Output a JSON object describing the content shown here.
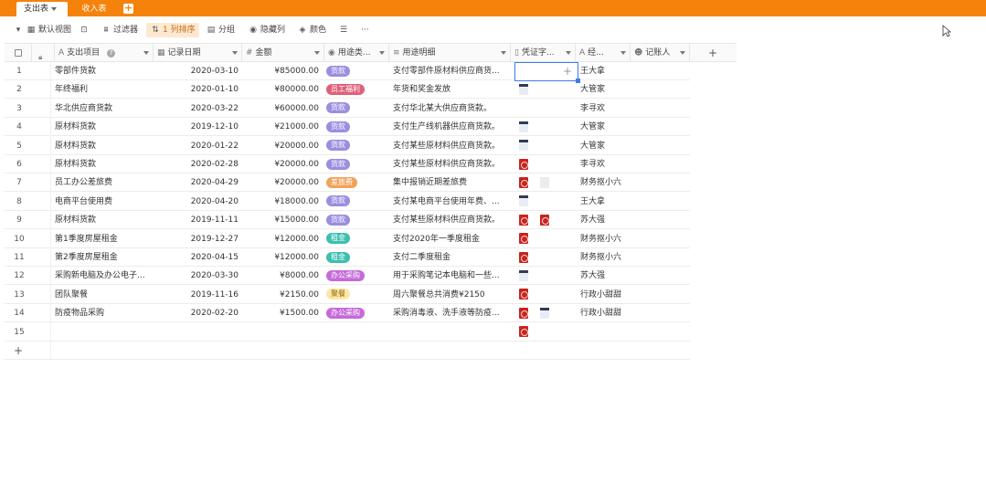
{
  "tabs": {
    "active": "支出表",
    "other": "收入表"
  },
  "toolbar": {
    "default_view": "默认视图",
    "filter": "过滤器",
    "sort": "1 列排序",
    "group": "分组",
    "hide": "隐藏列",
    "color": "颜色",
    "more": "···"
  },
  "columns": {
    "item": "支出项目",
    "date": "记录日期",
    "amount": "金额",
    "category": "用途类...",
    "description": "用途明细",
    "voucher": "凭证字...",
    "handler": "经...",
    "recorder": "记账人"
  },
  "rows": [
    {
      "idx": "1",
      "item": "零部件货款",
      "date": "2020-03-10",
      "amount": "¥85000.00",
      "cat": "货款",
      "desc": "支付零部件原材料供应商货...",
      "voucher": [],
      "handler": "王大拿"
    },
    {
      "idx": "2",
      "item": "年终福利",
      "date": "2020-01-10",
      "amount": "¥80000.00",
      "cat": "员工福利",
      "desc": "年货和奖金发放",
      "voucher": [
        "doc"
      ],
      "handler": "大管家"
    },
    {
      "idx": "3",
      "item": "华北供应商货款",
      "date": "2020-03-22",
      "amount": "¥60000.00",
      "cat": "货款",
      "desc": "支付华北某大供应商货款。",
      "voucher": [],
      "handler": "李寻欢"
    },
    {
      "idx": "4",
      "item": "原材料货款",
      "date": "2019-12-10",
      "amount": "¥21000.00",
      "cat": "货款",
      "desc": "支付生产线机器供应商货款。",
      "voucher": [
        "doc"
      ],
      "handler": "大管家"
    },
    {
      "idx": "5",
      "item": "原材料货款",
      "date": "2020-01-22",
      "amount": "¥20000.00",
      "cat": "货款",
      "desc": "支付某些原材料供应商货款。",
      "voucher": [
        "doc"
      ],
      "handler": "大管家"
    },
    {
      "idx": "6",
      "item": "原材料货款",
      "date": "2020-02-28",
      "amount": "¥20000.00",
      "cat": "货款",
      "desc": "支付某些原材料供应商货款。",
      "voucher": [
        "pdf"
      ],
      "handler": "李寻欢"
    },
    {
      "idx": "7",
      "item": "员工办公差旅费",
      "date": "2020-04-29",
      "amount": "¥20000.00",
      "cat": "差旅费",
      "desc": "集中报销近期差旅费",
      "voucher": [
        "pdf",
        "blank"
      ],
      "handler": "财务抠小六"
    },
    {
      "idx": "8",
      "item": "电商平台使用费",
      "date": "2020-04-20",
      "amount": "¥18000.00",
      "cat": "货款",
      "desc": "支付某电商平台使用年费、...",
      "voucher": [
        "doc"
      ],
      "handler": "王大拿"
    },
    {
      "idx": "9",
      "item": "原材料货款",
      "date": "2019-11-11",
      "amount": "¥15000.00",
      "cat": "货款",
      "desc": "支付某些原材料供应商货款。",
      "voucher": [
        "pdf",
        "pdf"
      ],
      "handler": "苏大强"
    },
    {
      "idx": "10",
      "item": "第1季度房屋租金",
      "date": "2019-12-27",
      "amount": "¥12000.00",
      "cat": "租金",
      "desc": "支付2020年一季度租金",
      "voucher": [
        "pdf"
      ],
      "handler": "财务抠小六"
    },
    {
      "idx": "11",
      "item": "第2季度房屋租金",
      "date": "2020-04-15",
      "amount": "¥12000.00",
      "cat": "租金",
      "desc": "支付二季度租金",
      "voucher": [
        "pdf"
      ],
      "handler": "财务抠小六"
    },
    {
      "idx": "12",
      "item": "采购新电脑及办公电子...",
      "date": "2020-03-30",
      "amount": "¥8000.00",
      "cat": "办公采购",
      "desc": "用于采购笔记本电脑和一些...",
      "voucher": [
        "doc"
      ],
      "handler": "苏大强"
    },
    {
      "idx": "13",
      "item": "团队聚餐",
      "date": "2019-11-16",
      "amount": "¥2150.00",
      "cat": "聚餐",
      "desc": "周六聚餐总共消费¥2150",
      "voucher": [
        "pdf"
      ],
      "handler": "行政小甜甜"
    },
    {
      "idx": "14",
      "item": "防疫物品采购",
      "date": "2020-02-20",
      "amount": "¥1500.00",
      "cat": "办公采购",
      "desc": "采购消毒液、洗手液等防疫...",
      "voucher": [
        "pdf",
        "doc"
      ],
      "handler": "行政小甜甜"
    },
    {
      "idx": "15",
      "item": "",
      "date": "",
      "amount": "",
      "cat": "",
      "desc": "",
      "voucher": [
        "pdf"
      ],
      "handler": ""
    }
  ],
  "category_colors": {
    "货款": "#9b8ee0",
    "员工福利": "#e0607a",
    "差旅费": "#f0a35a",
    "租金": "#3dbfb0",
    "办公采购": "#c56ad9",
    "聚餐": "#fde7a6"
  },
  "add_row": "+",
  "add_column": "+"
}
